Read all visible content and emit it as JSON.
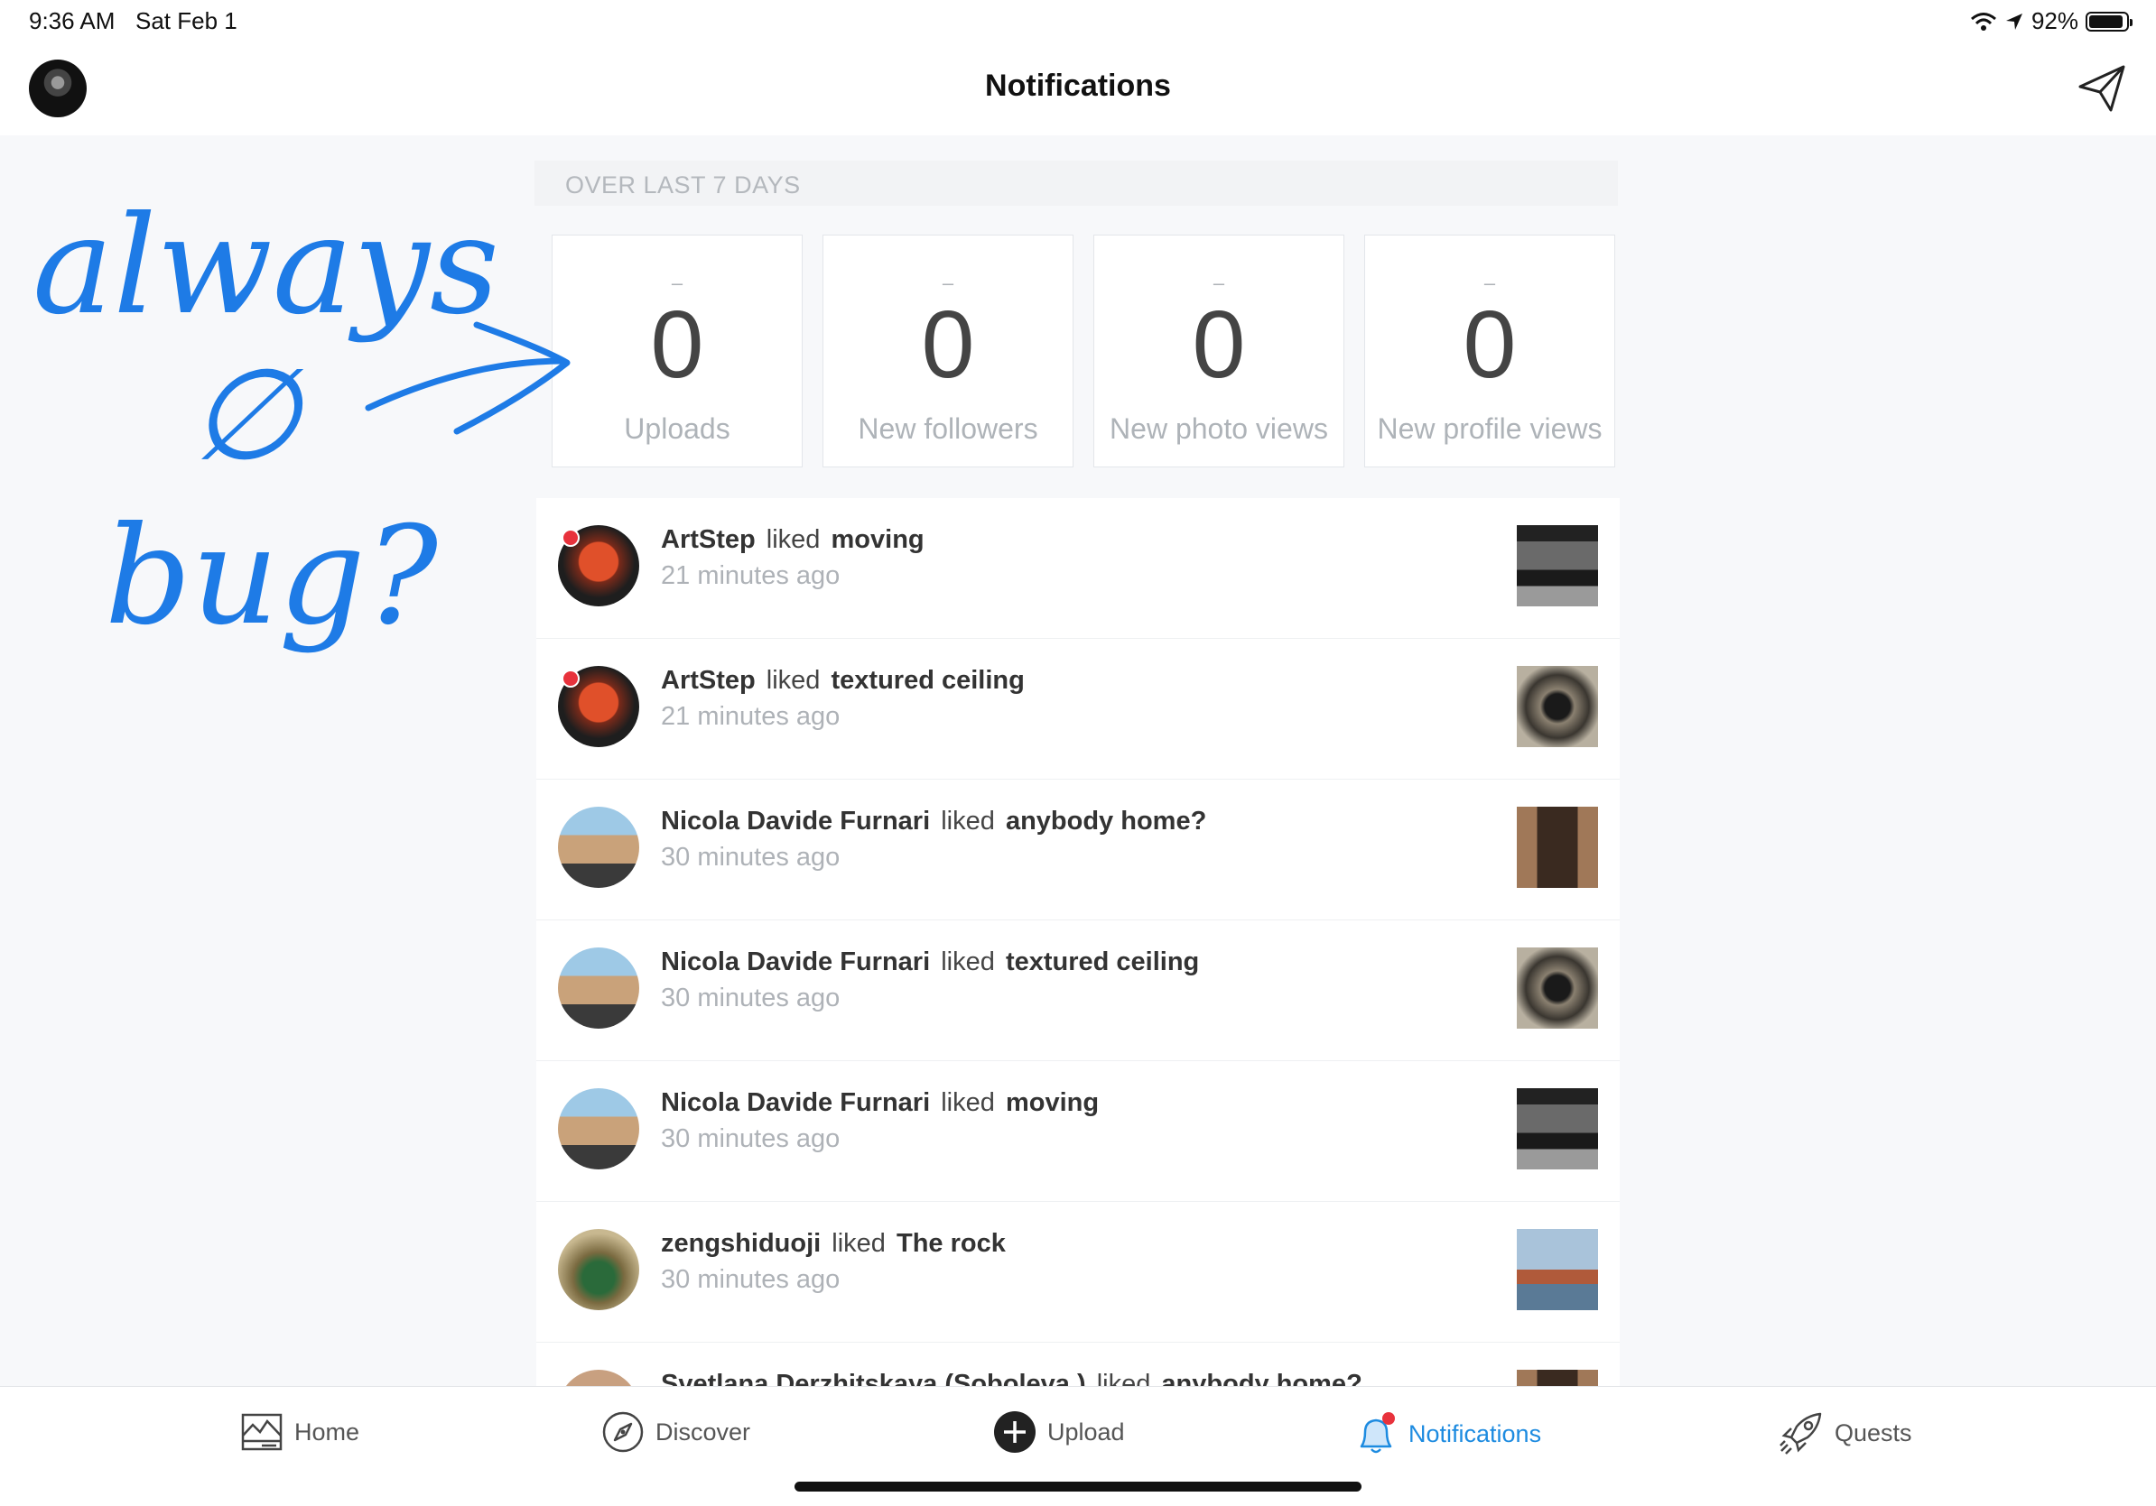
{
  "status_bar": {
    "time": "9:36 AM",
    "date": "Sat Feb 1",
    "battery_percent": "92%",
    "battery_level": 0.92
  },
  "header": {
    "title": "Notifications"
  },
  "stats": {
    "period_label": "OVER LAST 7 DAYS",
    "cards": [
      {
        "dash": "–",
        "value": "0",
        "label": "Uploads"
      },
      {
        "dash": "–",
        "value": "0",
        "label": "New followers"
      },
      {
        "dash": "–",
        "value": "0",
        "label": "New photo views"
      },
      {
        "dash": "–",
        "value": "0",
        "label": "New profile views"
      }
    ]
  },
  "annotation": {
    "line1": "always",
    "line2": "∅",
    "line3": "bug?",
    "color": "#1e7be6"
  },
  "notifications": [
    {
      "actor": "ArtStep",
      "verb": "liked",
      "photo": "moving",
      "time": "21 minutes ago",
      "unread": true
    },
    {
      "actor": "ArtStep",
      "verb": "liked",
      "photo": "textured ceiling",
      "time": "21 minutes ago",
      "unread": true
    },
    {
      "actor": "Nicola Davide Furnari",
      "verb": "liked",
      "photo": "anybody home?",
      "time": "30 minutes ago",
      "unread": false
    },
    {
      "actor": "Nicola Davide Furnari",
      "verb": "liked",
      "photo": "textured ceiling",
      "time": "30 minutes ago",
      "unread": false
    },
    {
      "actor": "Nicola Davide Furnari",
      "verb": "liked",
      "photo": "moving",
      "time": "30 minutes ago",
      "unread": false
    },
    {
      "actor": "zengshiduoji",
      "verb": "liked",
      "photo": "The rock",
      "time": "30 minutes ago",
      "unread": false
    },
    {
      "actor": "Svetlana Derzhitskaya (Soboleva )",
      "verb": "liked",
      "photo": "anybody home?",
      "time": "",
      "unread": false
    }
  ],
  "tabbar": {
    "home": "Home",
    "discover": "Discover",
    "upload": "Upload",
    "notifications": "Notifications",
    "quests": "Quests",
    "active_color": "#1d8be0"
  }
}
